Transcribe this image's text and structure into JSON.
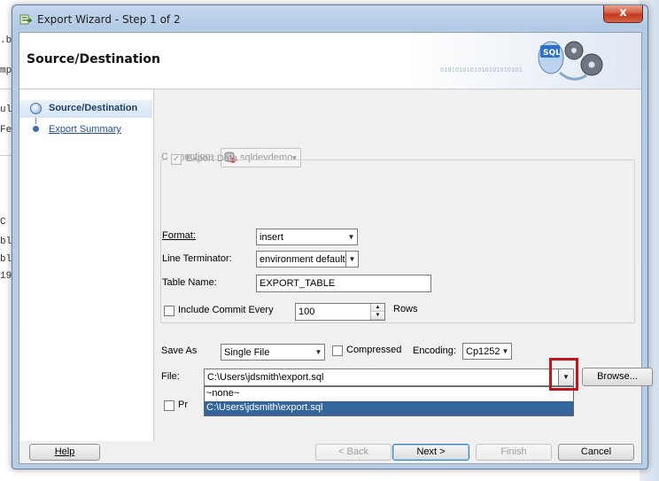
{
  "background": {
    "fragments": [
      {
        "text": ".b"
      },
      {
        "text": "mp"
      },
      {
        "text": "ult"
      },
      {
        "text": "Fet"
      },
      {
        "text": "C"
      },
      {
        "text": "bl"
      },
      {
        "text": "bl"
      },
      {
        "text": "19"
      }
    ]
  },
  "window": {
    "title": "Export Wizard - Step 1 of 2",
    "close_glyph": "x"
  },
  "header": {
    "title": "Source/Destination",
    "graphic_binary": "0101010101010101010101",
    "graphic_label": "SQL"
  },
  "nav": {
    "items": [
      {
        "label": "Source/Destination",
        "selected": true
      },
      {
        "label": "Export Summary",
        "selected": false
      }
    ]
  },
  "form": {
    "connection": {
      "label": "Connection:",
      "value": "sqldevdemo"
    },
    "export_data": {
      "label": "Export Data",
      "checked": true
    },
    "format": {
      "label": "Format:",
      "value": "insert"
    },
    "line_terminator": {
      "label": "Line Terminator:",
      "value": "environment default"
    },
    "table_name": {
      "label": "Table Name:",
      "value": "EXPORT_TABLE"
    },
    "include_commit": {
      "label": "Include Commit Every",
      "value": "100",
      "suffix": "Rows"
    },
    "save_as": {
      "label": "Save As",
      "value": "Single File"
    },
    "compressed": {
      "label": "Compressed",
      "checked": false
    },
    "encoding": {
      "label": "Encoding:",
      "value": "Cp1252"
    },
    "file": {
      "label": "File:",
      "value": "C:\\Users\\jdsmith\\export.sql",
      "options": [
        "~none~",
        "C:\\Users\\jdsmith\\export.sql"
      ],
      "selected_index": 1
    },
    "browse_label": "Browse...",
    "hidden_checkbox_label_fragment": "Pr"
  },
  "footer": {
    "help": "Help",
    "back": "< Back",
    "next": "Next >",
    "finish": "Finish",
    "cancel": "Cancel"
  },
  "colors": {
    "highlight": "#c0141a",
    "selection": "#34659b",
    "nav_text": "#1f3d6b"
  }
}
